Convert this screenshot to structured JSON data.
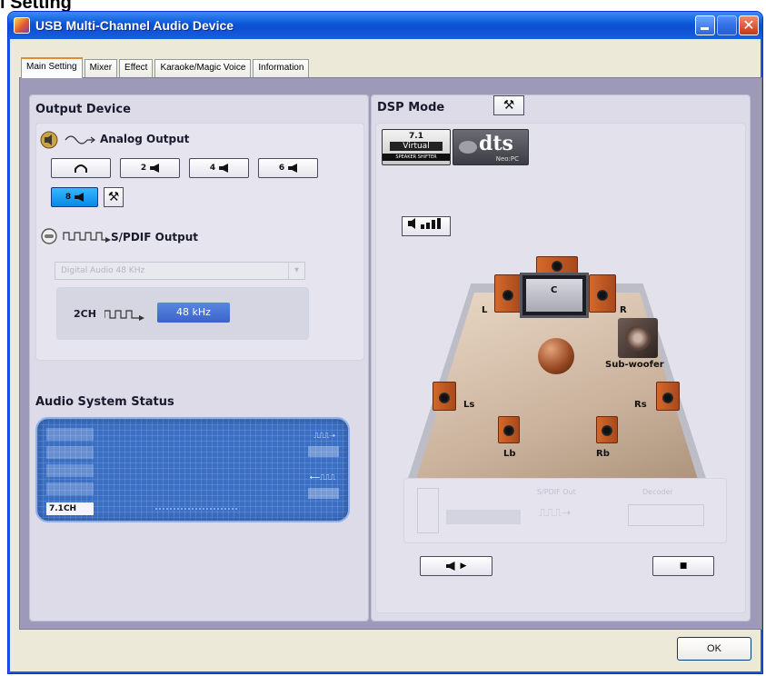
{
  "page_heading": "l Setting",
  "window": {
    "title": "USB Multi-Channel Audio Device",
    "close_glyph": "✕"
  },
  "tabs": [
    {
      "label": "Main Setting",
      "active": true
    },
    {
      "label": "Mixer",
      "active": false
    },
    {
      "label": "Effect",
      "active": false
    },
    {
      "label": "Karaoke/Magic Voice",
      "active": false
    },
    {
      "label": "Information",
      "active": false
    }
  ],
  "output_device": {
    "title": "Output Device",
    "analog_label": "Analog Output",
    "speaker_buttons": [
      {
        "label": "",
        "icon": "headphone-icon",
        "selected": false
      },
      {
        "label": "2",
        "icon": "speaker-icon",
        "selected": false
      },
      {
        "label": "4",
        "icon": "speaker-icon",
        "selected": false
      },
      {
        "label": "6",
        "icon": "speaker-icon",
        "selected": false
      },
      {
        "label": "8",
        "icon": "speaker-icon",
        "selected": true
      }
    ],
    "spdif_label": "S/PDIF Output",
    "spdif_dropdown_value": "Digital Audio 48 KHz",
    "channel_label": "2CH",
    "sample_rate": "48 kHz"
  },
  "audio_status": {
    "title": "Audio System Status",
    "channel": "7.1CH"
  },
  "dsp": {
    "title": "DSP Mode",
    "virtual": {
      "line1": "7.1",
      "line2": "Virtual",
      "line3": "SPEAKER SHIFTER"
    },
    "dts": {
      "logo": "dts",
      "sub": "Neo:PC"
    },
    "speakers": {
      "left": "L",
      "center": "C",
      "right": "R",
      "subwoofer": "Sub-woofer",
      "left_surround": "Ls",
      "right_surround": "Rs",
      "left_back": "Lb",
      "right_back": "Rb"
    },
    "spdif_out_label": "S/PDIF Out",
    "decoder_label": "Decoder"
  },
  "footer": {
    "ok_label": "OK"
  },
  "colors": {
    "title_bar": "#0a56d8",
    "client_bg": "#9c9ab8",
    "panel_bg": "#dcdbe7",
    "selected_btn": "#0888e8",
    "khz_chip": "#3a64c8",
    "status_screen": "#3b6fc4",
    "active_tab_accent": "#e68b2c"
  }
}
